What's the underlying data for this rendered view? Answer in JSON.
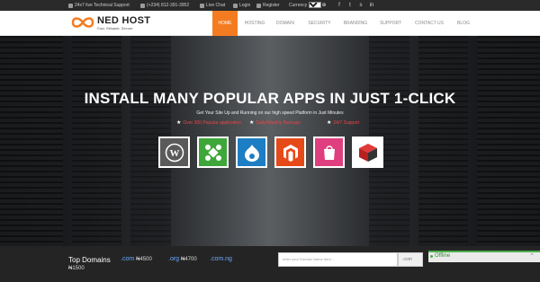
{
  "topbar": {
    "support": "24x7 live Technical Support",
    "phone": "(+234) 812-391-3952",
    "live_chat": "Live Chat",
    "login": "Login",
    "register": "Register",
    "currency_label": "Currency",
    "currency_value": "NGN",
    "social": [
      "facebook-icon",
      "twitter-icon",
      "skype-icon",
      "linkedin-icon"
    ]
  },
  "logo": {
    "name": "NED HOST",
    "tagline": "Fast, Reliable, Secure"
  },
  "nav": {
    "items": [
      "HOME",
      "HOSTING",
      "DOMAIN",
      "SECURITY",
      "BRANDING",
      "SUPPORT",
      "CONTACT US",
      "BLOG"
    ],
    "active": "HOME",
    "accent": "#f47c20"
  },
  "hero": {
    "headline": "INSTALL MANY POPULAR APPS IN JUST 1-CLICK",
    "subline": "Get Your Site Up and Running on our high speed Platform in Just Minutes",
    "features": [
      "Over 300 Popular application",
      "Daily/Weekly Backups",
      "24/7 Support"
    ],
    "apps": [
      {
        "name": "wordpress-icon",
        "color": "#5a5a5a"
      },
      {
        "name": "joomla-icon",
        "color": "#3fa63a"
      },
      {
        "name": "drupal-icon",
        "color": "#1d7ec3"
      },
      {
        "name": "magento-icon",
        "color": "#e64a19"
      },
      {
        "name": "prestashop-icon",
        "color": "#df3f7e"
      },
      {
        "name": "opencart-icon",
        "color": "#ffffff"
      }
    ]
  },
  "bottombar": {
    "title": "Top Domains",
    "tlds": [
      {
        "ext": ".com",
        "price": "₦4500"
      },
      {
        "ext": ".org",
        "price": "₦4700"
      },
      {
        "ext": ".com.ng",
        "price": "₦1500"
      }
    ],
    "search_placeholder": "enter your Domain Name here...",
    "tld_select": ".com"
  },
  "chat": {
    "status": "Offline",
    "status_color": "#4cae4c"
  }
}
